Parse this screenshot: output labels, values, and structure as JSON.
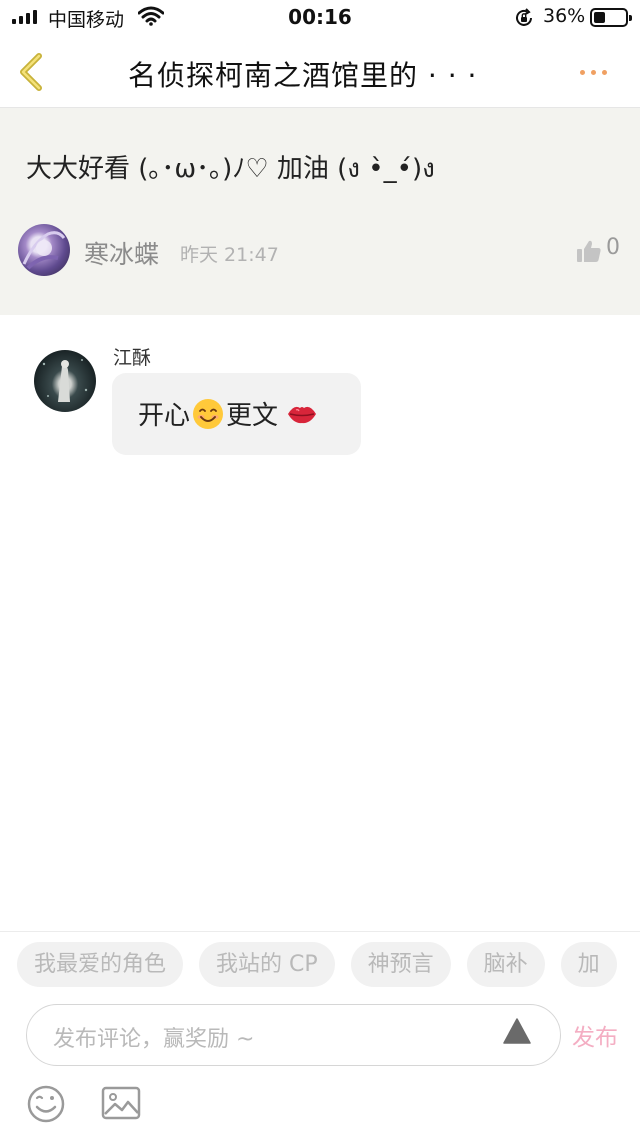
{
  "status_bar": {
    "carrier": "中国移动",
    "time": "00:16",
    "battery_percent": "36%",
    "battery_level": 0.36
  },
  "nav": {
    "title": "名侦探柯南之酒馆里的 · · ·",
    "back_icon": "chevron-left-icon",
    "more_icon": "more-dots-icon",
    "accent_color": "#f0a062"
  },
  "original_comment": {
    "text": "大大好看 (｡･ω･｡)ﾉ♡ 加油 (ง •̀_•́)ง",
    "user": "寒冰蝶",
    "time": "昨天 21:47",
    "like_count": "0"
  },
  "reply": {
    "user": "江酥",
    "text_before": "开心",
    "text_after": "更文"
  },
  "topic_chips": [
    "我最爱的角色",
    "我站的 CP",
    "神预言",
    "脑补",
    "加"
  ],
  "input": {
    "placeholder": "发布评论，赢奖励 ~",
    "publish_label": "发布",
    "publish_color": "#f4aec3"
  }
}
